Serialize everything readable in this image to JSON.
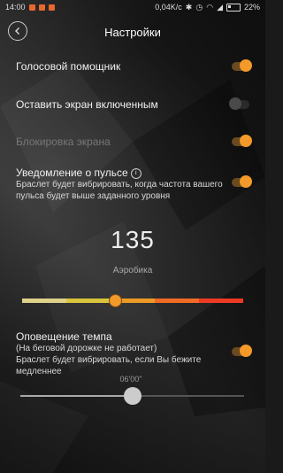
{
  "statusbar": {
    "time": "14:00",
    "speed": "0,04K/c",
    "battery": "22%"
  },
  "header": {
    "title": "Настройки"
  },
  "settings": {
    "voice": {
      "label": "Голосовой помощник",
      "on": true
    },
    "screen_on": {
      "label": "Оставить экран включенным",
      "on": false
    },
    "lock": {
      "label": "Блокировка экрана",
      "on": true
    },
    "pulse": {
      "label": "Уведомление о пульсе",
      "info_icon": "i",
      "description": "Браслет будет вибрировать, когда частота вашего пульса будет выше заданного уровня",
      "on": true,
      "value": "135",
      "zone": "Аэробика",
      "zone_colors": [
        "#ded189",
        "#d9c53b",
        "#eb9b25",
        "#f06a25",
        "#ee3a22"
      ],
      "slider_fraction": 0.42
    },
    "tempo": {
      "title": "Оповещение темпа",
      "note": "(На беговой дорожке не работает)",
      "description": "Браслет будет вибрировать, если Вы бежите медленнее",
      "on": true,
      "value": "06'00\"",
      "slider_fraction": 0.5
    }
  },
  "accent_color": "#f39a2b"
}
